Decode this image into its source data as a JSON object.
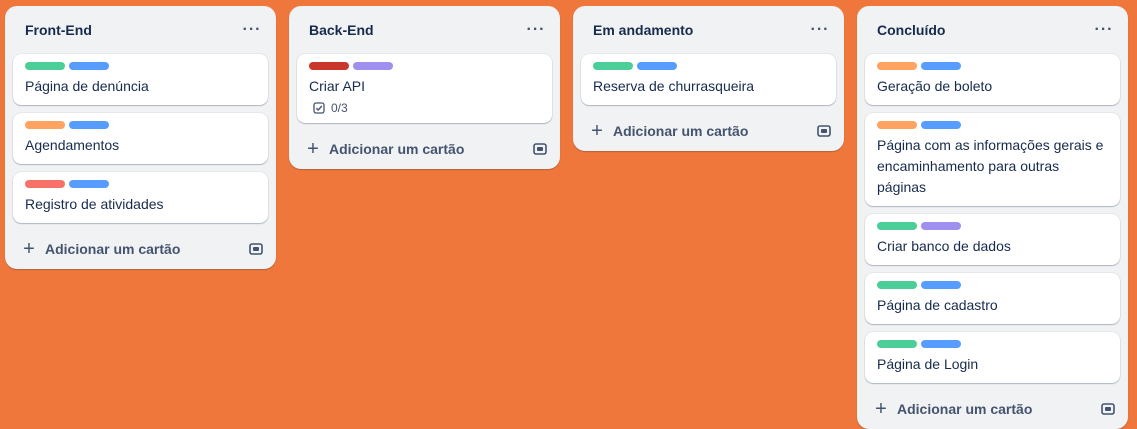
{
  "colors": {
    "board_bg": "#ef773b",
    "green": "#4bce97",
    "blue": "#579dff",
    "orange": "#fea362",
    "red_light": "#f87168",
    "red_dark": "#c9372c",
    "purple": "#9f8fef"
  },
  "lists": [
    {
      "title": "Front-End",
      "cards": [
        {
          "title": "Página de denúncia",
          "labels": [
            "green",
            "blue"
          ]
        },
        {
          "title": "Agendamentos",
          "labels": [
            "orange",
            "blue"
          ]
        },
        {
          "title": "Registro de atividades",
          "labels": [
            "red_light",
            "blue"
          ]
        }
      ],
      "add_label": "Adicionar um cartão"
    },
    {
      "title": "Back-End",
      "cards": [
        {
          "title": "Criar API",
          "labels": [
            "red_dark",
            "purple"
          ],
          "checklist": "0/3"
        }
      ],
      "add_label": "Adicionar um cartão"
    },
    {
      "title": "Em andamento",
      "cards": [
        {
          "title": "Reserva de churrasqueira",
          "labels": [
            "green",
            "blue"
          ]
        }
      ],
      "add_label": "Adicionar um cartão"
    },
    {
      "title": "Concluído",
      "cards": [
        {
          "title": "Geração de boleto",
          "labels": [
            "orange",
            "blue"
          ]
        },
        {
          "title": "Página com as informações gerais e encaminhamento para outras páginas",
          "labels": [
            "orange",
            "blue"
          ]
        },
        {
          "title": "Criar banco de dados",
          "labels": [
            "green",
            "purple"
          ]
        },
        {
          "title": "Página de cadastro",
          "labels": [
            "green",
            "blue"
          ]
        },
        {
          "title": "Página de Login",
          "labels": [
            "green",
            "blue"
          ]
        }
      ],
      "add_label": "Adicionar um cartão"
    }
  ],
  "icons": {
    "list_menu": "more-horizontal-icon",
    "add": "plus-icon",
    "template": "card-template-icon",
    "checklist": "checklist-icon"
  },
  "menu_glyph": "···",
  "plus_glyph": "+"
}
